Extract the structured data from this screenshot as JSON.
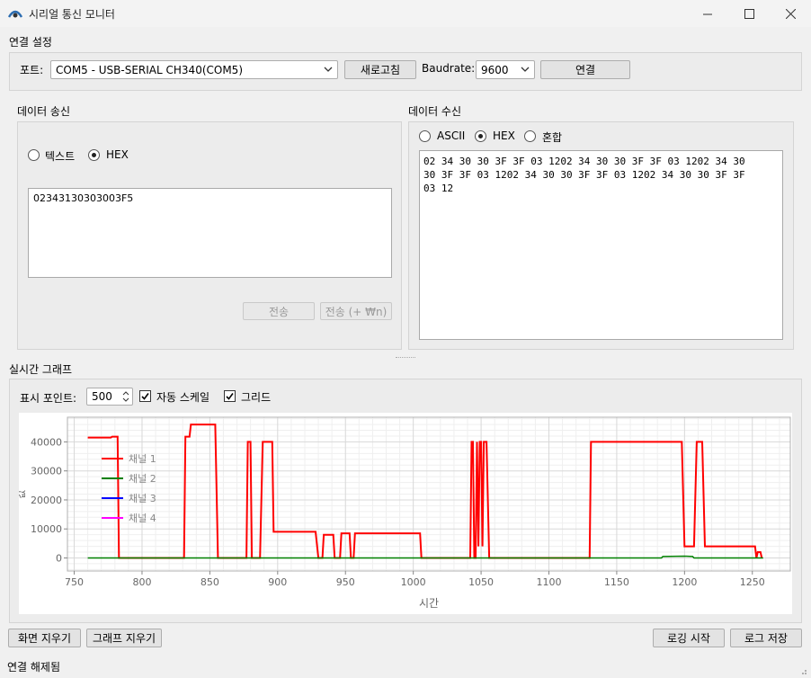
{
  "window": {
    "title": "시리얼 통신 모니터",
    "minimize_glyph": "—",
    "maximize_glyph": "☐",
    "close_glyph": "✕"
  },
  "connection": {
    "group_title": "연결 설정",
    "port_label": "포트:",
    "port_value": "COM5 - USB-SERIAL CH340(COM5)",
    "refresh_button": "새로고침",
    "baudrate_label": "Baudrate:",
    "baudrate_value": "9600",
    "connect_button": "연결"
  },
  "send": {
    "group_title": "데이터 송신",
    "mode_text": "텍스트",
    "mode_hex": "HEX",
    "selected_mode": "HEX",
    "input_value": "02343130303003F5",
    "send_button": "전송",
    "send_newline_button": "전송 (+ ₩n)"
  },
  "receive": {
    "group_title": "데이터 수신",
    "mode_ascii": "ASCII",
    "mode_hex": "HEX",
    "mode_mixed": "혼합",
    "selected_mode": "HEX",
    "content": "02 34 30 30 3F 3F 03 1202 34 30 30 3F 3F 03 1202 34 30\n30 3F 3F 03 1202 34 30 30 3F 3F 03 1202 34 30 30 3F 3F\n03 12"
  },
  "graph": {
    "group_title": "실시간 그래프",
    "points_label": "표시 포인트:",
    "points_value": "500",
    "autoscale_label": "자동 스케일",
    "autoscale_checked": true,
    "grid_label": "그리드",
    "grid_checked": true
  },
  "chart_data": {
    "type": "line",
    "xlabel": "시간",
    "ylabel": "값",
    "xlim": [
      745,
      1278
    ],
    "ylim": [
      -4500,
      48500
    ],
    "x_ticks": [
      750,
      800,
      850,
      900,
      950,
      1000,
      1050,
      1100,
      1150,
      1200,
      1250
    ],
    "y_ticks": [
      0,
      10000,
      20000,
      30000,
      40000
    ],
    "grid": true,
    "legend_position": "top-left",
    "series": [
      {
        "name": "채널 1",
        "color": "#ff0000",
        "points": [
          [
            760,
            41500
          ],
          [
            777,
            41500
          ],
          [
            778,
            41800
          ],
          [
            782,
            41800
          ],
          [
            783,
            0
          ],
          [
            831,
            0
          ],
          [
            832,
            41800
          ],
          [
            835,
            41800
          ],
          [
            836,
            46000
          ],
          [
            854,
            46000
          ],
          [
            856,
            0
          ],
          [
            877,
            0
          ],
          [
            878,
            40000
          ],
          [
            880,
            40000
          ],
          [
            881,
            0
          ],
          [
            887,
            0
          ],
          [
            889,
            40000
          ],
          [
            896,
            40000
          ],
          [
            897,
            9000
          ],
          [
            928,
            9000
          ],
          [
            930,
            0
          ],
          [
            933,
            0
          ],
          [
            934,
            8000
          ],
          [
            941,
            8000
          ],
          [
            942,
            0
          ],
          [
            946,
            0
          ],
          [
            947,
            8500
          ],
          [
            953,
            8500
          ],
          [
            954,
            0
          ],
          [
            956,
            0
          ],
          [
            957,
            8500
          ],
          [
            1005,
            8500
          ],
          [
            1006,
            0
          ],
          [
            1042,
            0
          ],
          [
            1043,
            40000
          ],
          [
            1044,
            40000
          ],
          [
            1045,
            0
          ],
          [
            1046,
            0
          ],
          [
            1047,
            40000
          ],
          [
            1048,
            4000
          ],
          [
            1049,
            40000
          ],
          [
            1050,
            40000
          ],
          [
            1051,
            4000
          ],
          [
            1052,
            40000
          ],
          [
            1054,
            40000
          ],
          [
            1056,
            0
          ],
          [
            1130,
            0
          ],
          [
            1131,
            40000
          ],
          [
            1198,
            40000
          ],
          [
            1200,
            4000
          ],
          [
            1207,
            4000
          ],
          [
            1209,
            40000
          ],
          [
            1213,
            40000
          ],
          [
            1215,
            4000
          ],
          [
            1252,
            4000
          ],
          [
            1253,
            0
          ],
          [
            1254,
            2000
          ],
          [
            1256,
            2000
          ],
          [
            1257,
            0
          ]
        ]
      },
      {
        "name": "채널 2",
        "color": "#008000",
        "points": [
          [
            760,
            0
          ],
          [
            1183,
            0
          ],
          [
            1184,
            500
          ],
          [
            1200,
            600
          ],
          [
            1206,
            500
          ],
          [
            1207,
            0
          ],
          [
            1258,
            0
          ]
        ]
      },
      {
        "name": "채널 3",
        "color": "#0000ff",
        "points": []
      },
      {
        "name": "채널 4",
        "color": "#ff00ff",
        "points": []
      }
    ]
  },
  "footer": {
    "clear_screen_button": "화면 지우기",
    "clear_graph_button": "그래프 지우기",
    "start_logging_button": "로깅 시작",
    "save_log_button": "로그 저장",
    "status_text": "연결 해제됨"
  }
}
